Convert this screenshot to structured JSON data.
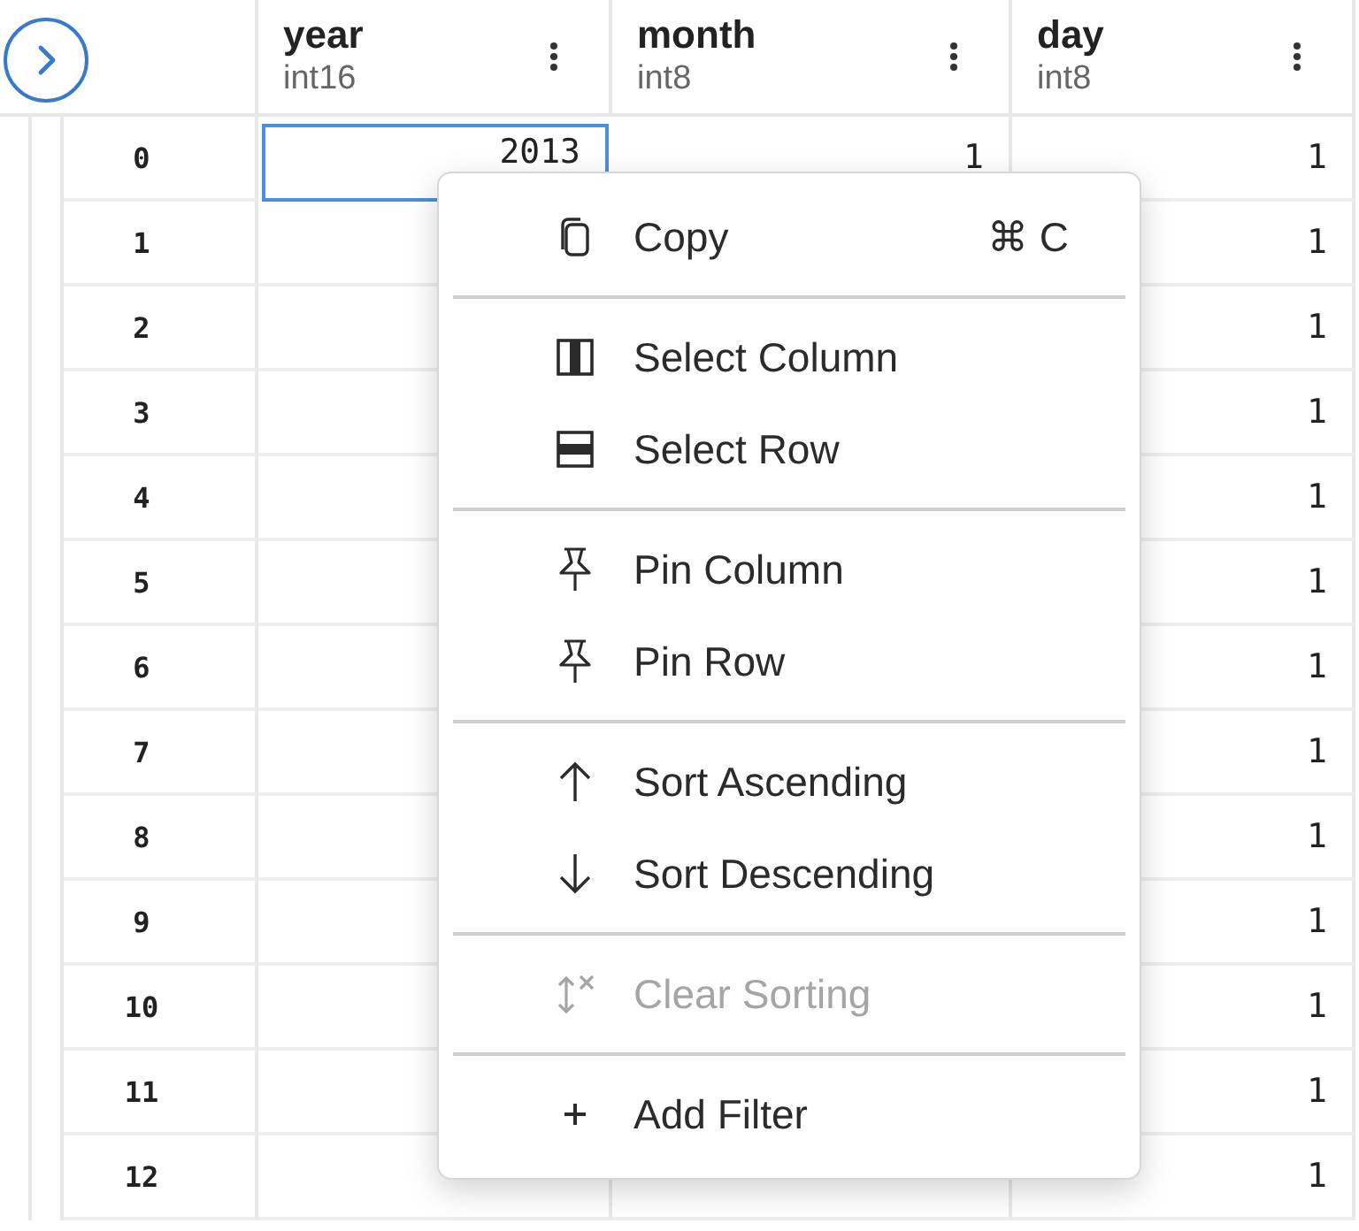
{
  "columns": [
    {
      "name": "year",
      "type": "int16"
    },
    {
      "name": "month",
      "type": "int8"
    },
    {
      "name": "day",
      "type": "int8"
    }
  ],
  "rows": [
    {
      "index": "0",
      "cells": [
        {
          "value": "2013",
          "selected": true
        },
        {
          "value": "1",
          "selected": false
        },
        {
          "value": "1",
          "selected": false
        }
      ]
    },
    {
      "index": "1",
      "cells": [
        {
          "selected": false
        },
        null,
        {
          "value": "1",
          "selected": false
        }
      ]
    },
    {
      "index": "2",
      "cells": [
        {
          "selected": false
        },
        null,
        {
          "value": "1",
          "selected": false
        }
      ]
    },
    {
      "index": "3",
      "cells": [
        {
          "selected": false
        },
        null,
        {
          "value": "1",
          "selected": false
        }
      ]
    },
    {
      "index": "4",
      "cells": [
        {
          "selected": false
        },
        null,
        {
          "value": "1",
          "selected": false
        }
      ]
    },
    {
      "index": "5",
      "cells": [
        {
          "selected": false
        },
        null,
        {
          "value": "1",
          "selected": false
        }
      ]
    },
    {
      "index": "6",
      "cells": [
        {
          "selected": false
        },
        null,
        {
          "value": "1",
          "selected": false
        }
      ]
    },
    {
      "index": "7",
      "cells": [
        {
          "selected": false
        },
        null,
        {
          "value": "1",
          "selected": false
        }
      ]
    },
    {
      "index": "8",
      "cells": [
        {
          "selected": false
        },
        null,
        {
          "value": "1",
          "selected": false
        }
      ]
    },
    {
      "index": "9",
      "cells": [
        {
          "selected": false
        },
        null,
        {
          "value": "1",
          "selected": false
        }
      ]
    },
    {
      "index": "10",
      "cells": [
        {
          "selected": false
        },
        null,
        {
          "value": "1",
          "selected": false
        }
      ]
    },
    {
      "index": "11",
      "cells": [
        {
          "selected": false
        },
        null,
        {
          "value": "1",
          "selected": false
        }
      ]
    },
    {
      "index": "12",
      "cells": [
        {
          "selected": false
        },
        {
          "selected": false
        },
        {
          "value": "1",
          "selected": false
        }
      ]
    }
  ],
  "context_menu": {
    "sections": [
      [
        {
          "kind": "copy",
          "label": "Copy",
          "shortcut": "⌘ C",
          "disabled": false
        }
      ],
      [
        {
          "kind": "select-column",
          "label": "Select Column",
          "disabled": false
        },
        {
          "kind": "select-row",
          "label": "Select Row",
          "disabled": false
        }
      ],
      [
        {
          "kind": "pin",
          "label": "Pin Column",
          "disabled": false
        },
        {
          "kind": "pin",
          "label": "Pin Row",
          "disabled": false
        }
      ],
      [
        {
          "kind": "sort-up",
          "label": "Sort Ascending",
          "disabled": false
        },
        {
          "kind": "sort-down",
          "label": "Sort Descending",
          "disabled": false
        }
      ],
      [
        {
          "kind": "clear-sort",
          "label": "Clear Sorting",
          "disabled": true
        }
      ],
      [
        {
          "kind": "add",
          "label": "Add Filter",
          "disabled": false
        }
      ]
    ]
  }
}
